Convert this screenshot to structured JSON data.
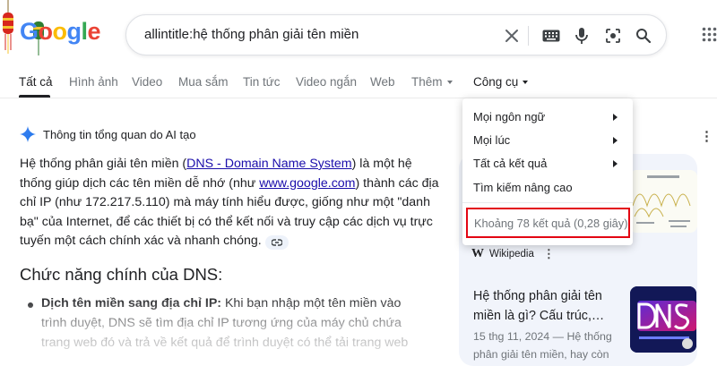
{
  "logo": {
    "text": "Google"
  },
  "search": {
    "query": "allintitle:hệ thống phân giải tên miền",
    "icons": [
      "close-icon",
      "keyboard-icon",
      "mic-icon",
      "lens-icon",
      "search-icon"
    ]
  },
  "tabs": [
    {
      "label": "Tất cả",
      "active": true
    },
    {
      "label": "Hình ảnh"
    },
    {
      "label": "Video"
    },
    {
      "label": "Mua sắm"
    },
    {
      "label": "Tin tức"
    },
    {
      "label": "Video ngắn"
    },
    {
      "label": "Web"
    },
    {
      "label": "Thêm"
    },
    {
      "label": "Công cụ"
    }
  ],
  "tools_menu": {
    "items": [
      {
        "label": "Mọi ngôn ngữ"
      },
      {
        "label": "Mọi lúc"
      },
      {
        "label": "Tất cả kết quả"
      },
      {
        "label": "Tìm kiếm nâng cao"
      }
    ],
    "result_stats": "Khoảng 78 kết quả (0,28 giây)"
  },
  "ai_overview": {
    "header": "Thông tin tổng quan do AI tạo",
    "para_1": "Hệ thống phân giải tên miền (",
    "para_link_1": "DNS - Domain Name System",
    "para_2": ") là một hệ thống giúp dịch các tên miền dễ nhớ (như ",
    "para_link_2": "www.google.com",
    "para_3": ") thành các địa chỉ IP (như 172.217.5.110) mà máy tính hiểu được, giống như một \"danh bạ\" của Internet, để các thiết bị có thể kết nối và truy cập các dịch vụ trực tuyến một cách chính xác và nhanh chóng.",
    "heading": "Chức năng chính của DNS:",
    "bullet_bold": "Dịch tên miền sang địa chỉ IP:",
    "bullet_text": " Khi bạn nhập một tên miền vào trình duyệt, DNS sẽ tìm địa chỉ IP tương ứng của máy chủ chứa trang web đó và trả về kết quả để trình duyệt có thể tải trang web"
  },
  "source_card": {
    "source": "Wikipedia",
    "title": "Hệ thống phân giải tên miền là gì? Cấu trúc,…",
    "snippet": "15 thg 11, 2024 — Hệ thống phân giải tên miền, hay còn"
  },
  "colors": {
    "google_blue": "#4285F4",
    "google_red": "#EA4335",
    "google_yellow": "#FBBC05",
    "google_green": "#34A853",
    "highlight_box": "#e30613",
    "link": "#1a0dab"
  }
}
